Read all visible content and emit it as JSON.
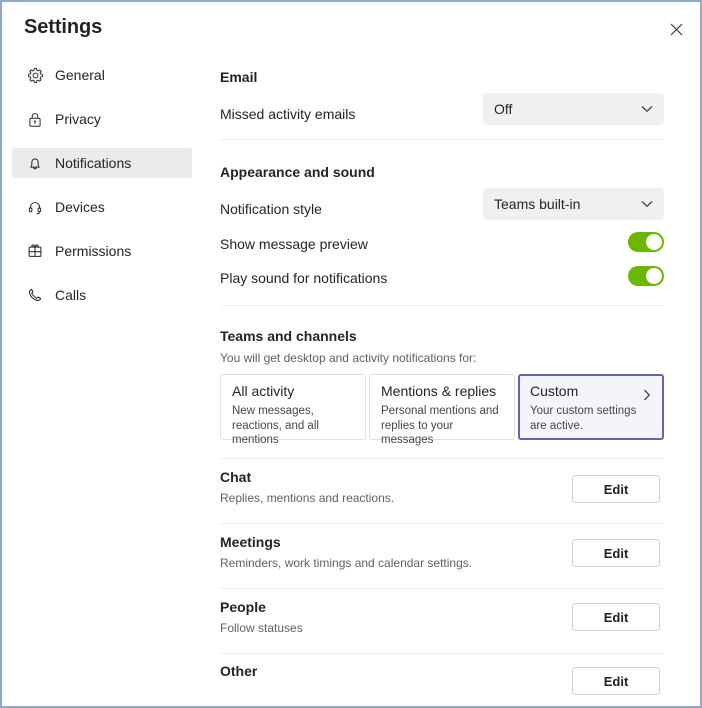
{
  "window": {
    "title": "Settings",
    "close_label": "Close"
  },
  "sidebar": {
    "items": [
      {
        "label": "General",
        "icon": "gear-icon",
        "active": false
      },
      {
        "label": "Privacy",
        "icon": "lock-icon",
        "active": false
      },
      {
        "label": "Notifications",
        "icon": "bell-icon",
        "active": true
      },
      {
        "label": "Devices",
        "icon": "headset-icon",
        "active": false
      },
      {
        "label": "Permissions",
        "icon": "permissions-icon",
        "active": false
      },
      {
        "label": "Calls",
        "icon": "phone-icon",
        "active": false
      }
    ]
  },
  "main": {
    "email": {
      "heading": "Email",
      "row_label": "Missed activity emails",
      "dropdown_value": "Off"
    },
    "appearance": {
      "heading": "Appearance and sound",
      "style_label": "Notification style",
      "style_value": "Teams built-in",
      "preview_label": "Show message preview",
      "preview_state": "on",
      "sound_label": "Play sound for notifications",
      "sound_state": "on"
    },
    "teams_channels": {
      "heading": "Teams and channels",
      "description": "You will get desktop and activity notifications for:",
      "cards": [
        {
          "title": "All activity",
          "desc": "New messages, reactions, and all mentions",
          "selected": false
        },
        {
          "title": "Mentions & replies",
          "desc": "Personal mentions and replies to your messages",
          "selected": false
        },
        {
          "title": "Custom",
          "desc": "Your custom settings are active.",
          "selected": true
        }
      ]
    },
    "sections": [
      {
        "heading": "Chat",
        "desc": "Replies, mentions and reactions.",
        "button": "Edit"
      },
      {
        "heading": "Meetings",
        "desc": "Reminders, work timings and calendar settings.",
        "button": "Edit"
      },
      {
        "heading": "People",
        "desc": "Follow statuses",
        "button": "Edit"
      },
      {
        "heading": "Other",
        "desc": "",
        "button": "Edit"
      }
    ]
  },
  "colors": {
    "accent_purple": "#6264a7",
    "toggle_green": "#6bb700",
    "window_border": "#91a9c9",
    "highlight_gray": "#ebebeb"
  }
}
